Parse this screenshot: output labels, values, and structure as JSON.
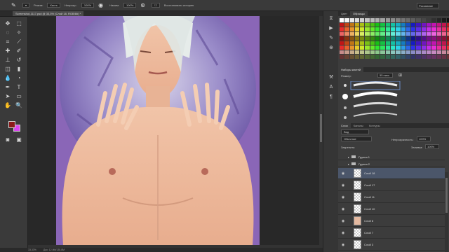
{
  "options": {
    "mode_label": "Режим:",
    "mode_value": "Кисть",
    "opacity_label": "Непрозр.:",
    "opacity_value": "100%",
    "hardness_label": "Нажим:",
    "hardness_value": "100%",
    "sample_label": "Восстановить историю",
    "workspace": "Рисование"
  },
  "document": {
    "tab_title": "Screenshot-1117.psd @ 33,3% (Слой 18, RGB/8#) *"
  },
  "status": {
    "zoom": "33,33%",
    "doc_size": "Док: 12,9M/135,8M"
  },
  "colors": {
    "foreground": "#8b1a1a",
    "background": "#d946ef",
    "canvas_bg": "#8a66b7"
  },
  "swatches_panel": {
    "tabs": [
      "Цвет",
      "Образцы"
    ],
    "active_tab": "Образцы"
  },
  "brush_panel": {
    "tabs": [
      "Наборы кистей"
    ],
    "size_label": "Размер:",
    "size_value": "55 пикс."
  },
  "layers_panel": {
    "tabs": [
      "Слои",
      "Каналы",
      "Контуры"
    ],
    "active_tab": "Слои",
    "kind_filter": "Вид",
    "blend_mode": "Обычные",
    "opacity_label": "Непрозрачность:",
    "opacity_value": "100%",
    "lock_label": "Закрепить:",
    "fill_label": "Заливка:",
    "fill_value": "100%",
    "groups": [
      {
        "name": "Группа 1"
      },
      {
        "name": "Группа 2"
      }
    ],
    "layers": [
      {
        "name": "Слой 18",
        "selected": true
      },
      {
        "name": "Слой 17",
        "selected": false
      },
      {
        "name": "Слой 11",
        "selected": false
      },
      {
        "name": "Слой 10",
        "selected": false
      },
      {
        "name": "Слой 8",
        "selected": false
      },
      {
        "name": "Слой 7",
        "selected": false
      },
      {
        "name": "Слой 3",
        "selected": false
      }
    ]
  }
}
